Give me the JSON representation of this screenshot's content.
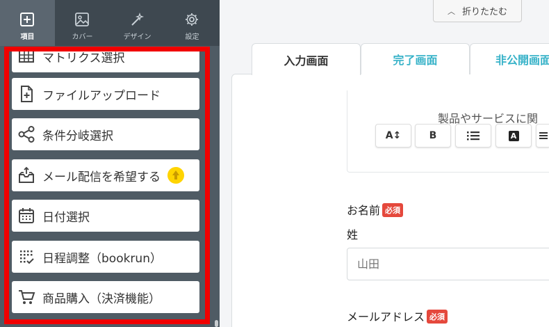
{
  "sidebar": {
    "top_tabs": [
      {
        "label": "項目",
        "icon": "plus-square-icon",
        "active": true
      },
      {
        "label": "カバー",
        "icon": "image-icon",
        "active": false
      },
      {
        "label": "デザイン",
        "icon": "magic-wand-icon",
        "active": false
      },
      {
        "label": "設定",
        "icon": "gear-icon",
        "active": false
      }
    ],
    "items": [
      {
        "label": "マトリクス選択",
        "icon": "grid-icon"
      },
      {
        "label": "ファイルアップロード",
        "icon": "file-plus-icon"
      },
      {
        "label": "条件分岐選択",
        "icon": "share-nodes-icon"
      },
      {
        "label": "メール配信を希望する",
        "icon": "mail-inbox-icon",
        "badge": "upgrade-icon"
      },
      {
        "label": "日付選択",
        "icon": "calendar-icon"
      },
      {
        "label": "日程調整（bookrun）",
        "icon": "calendar-check-icon"
      },
      {
        "label": "商品購入（決済機能）",
        "icon": "cart-icon"
      }
    ]
  },
  "header": {
    "collapse_label": "折りたたむ"
  },
  "tabs": [
    {
      "label": "入力画面",
      "active": true
    },
    {
      "label": "完了画面",
      "active": false
    },
    {
      "label": "非公開画面",
      "active": false
    }
  ],
  "editor": {
    "text": "製品やサービスに関",
    "toolbar": [
      "A↕",
      "B",
      "list-icon",
      "A",
      "align-icon"
    ]
  },
  "form": {
    "name_label": "お名前",
    "required": "必須",
    "surname_label": "姓",
    "surname_placeholder": "山田",
    "email_label": "メールアドレス"
  },
  "colors": {
    "sidebar_bg": "#4f5b64",
    "highlight_frame": "#f10000",
    "accent": "#36b2c8",
    "required": "#e5483c"
  }
}
